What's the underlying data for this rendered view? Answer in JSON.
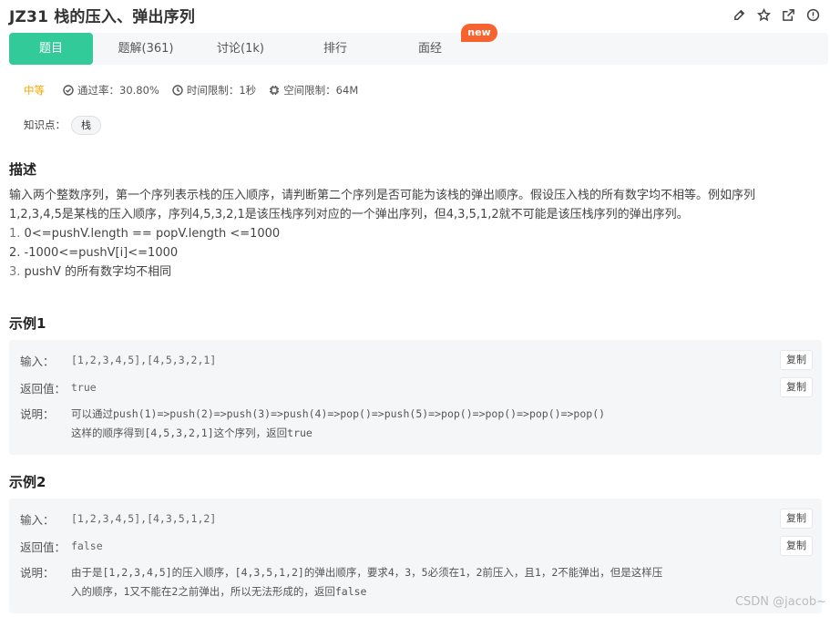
{
  "header": {
    "title": "JZ31  栈的压入、弹出序列"
  },
  "tabs": [
    {
      "label": "题目"
    },
    {
      "label": "题解(361)"
    },
    {
      "label": "讨论(1k)"
    },
    {
      "label": "排行"
    },
    {
      "label": "面经"
    }
  ],
  "new_badge": "new",
  "meta": {
    "difficulty": "中等",
    "pass_rate": "通过率：30.80%",
    "time_limit": "时间限制：1秒",
    "memory_limit": "空间限制：64M"
  },
  "knowledge": {
    "label": "知识点：",
    "tag": "栈"
  },
  "description": {
    "heading": "描述",
    "line1": "输入两个整数序列，第一个序列表示栈的压入顺序，请判断第二个序列是否可能为该栈的弹出顺序。假设压入栈的所有数字均不相等。例如序列",
    "line2": "1,2,3,4,5是某栈的压入顺序，序列4,5,3,2,1是该压栈序列对应的一个弹出序列，但4,3,5,1,2就不可能是该压栈序列的弹出序列。",
    "constraints": [
      {
        "num": "1.",
        "text": "0<=pushV.length == popV.length <=1000"
      },
      {
        "num": "2.",
        "text": "-1000<=pushV[i]<=1000"
      },
      {
        "num": "3.",
        "text": "pushV 的所有数字均不相同"
      }
    ]
  },
  "examples": [
    {
      "heading": "示例1",
      "input_label": "输入：",
      "input": "[1,2,3,4,5],[4,5,3,2,1]",
      "output_label": "返回值：",
      "output": "true",
      "explain_label": "说明：",
      "explain_line1": "可以通过push(1)=>push(2)=>push(3)=>push(4)=>pop()=>push(5)=>pop()=>pop()=>pop()=>pop()",
      "explain_line2": "这样的顺序得到[4,5,3,2,1]这个序列，返回true",
      "copy_label": "复制"
    },
    {
      "heading": "示例2",
      "input_label": "输入：",
      "input": "[1,2,3,4,5],[4,3,5,1,2]",
      "output_label": "返回值：",
      "output": "false",
      "explain_label": "说明：",
      "explain_line1": "由于是[1,2,3,4,5]的压入顺序，[4,3,5,1,2]的弹出顺序，要求4，3，5必须在1，2前压入，且1，2不能弹出，但是这样压",
      "explain_line2": "入的顺序，1又不能在2之前弹出，所以无法形成的，返回false",
      "copy_label": "复制"
    }
  ],
  "watermark": "CSDN @jacob~"
}
